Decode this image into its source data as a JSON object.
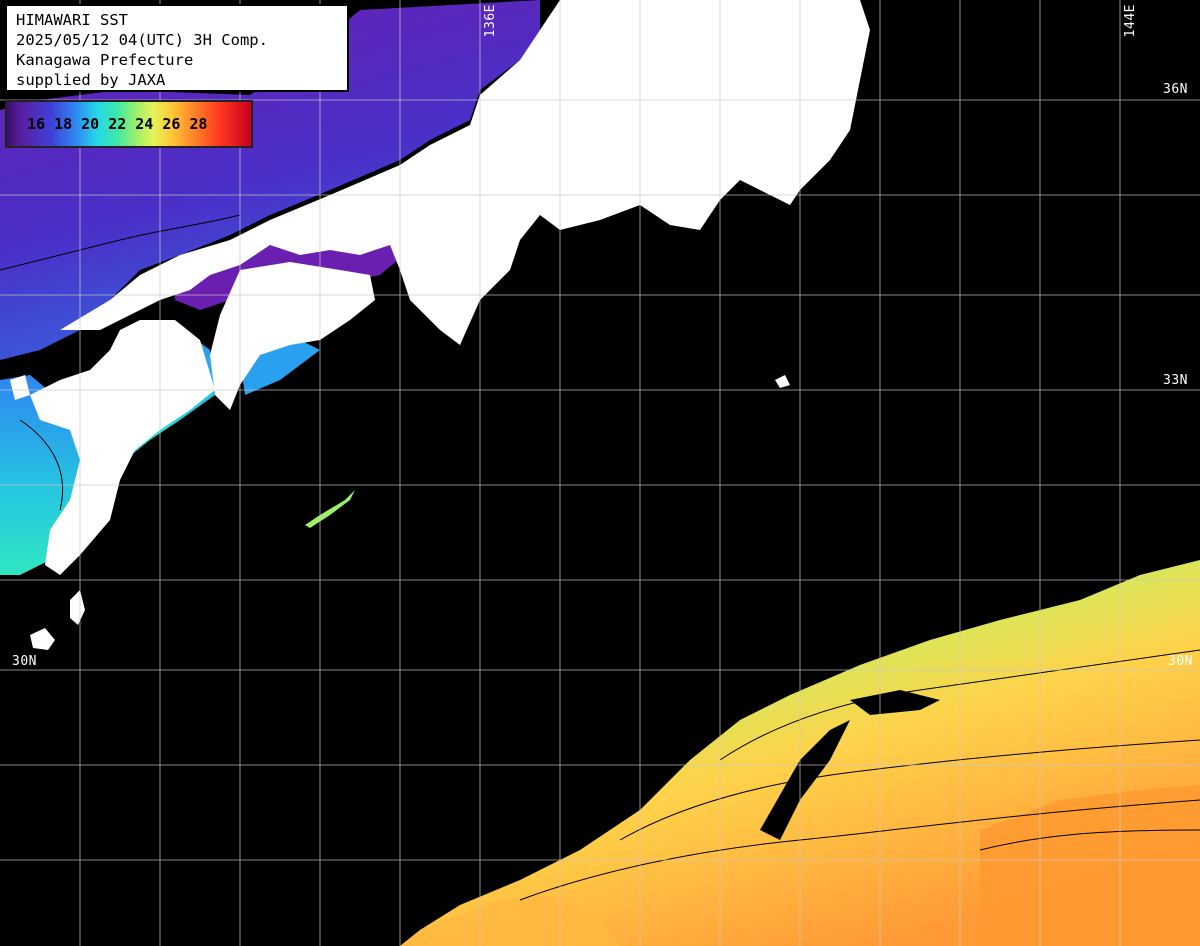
{
  "info": {
    "line1": "HIMAWARI SST",
    "line2": "2025/05/12 04(UTC) 3H Comp.",
    "line3": "Kanagawa Prefecture",
    "line4": "supplied by JAXA"
  },
  "legend": {
    "ticks": [
      "16",
      "18",
      "20",
      "22",
      "24",
      "26",
      "28"
    ],
    "colors": [
      "#3a0f6e",
      "#3f3fd8",
      "#25d8e8",
      "#9cf06a",
      "#ffc435",
      "#ff7a26",
      "#c8001e"
    ]
  },
  "grid": {
    "lat_labels": {
      "lat36": "36N",
      "lat33": "33N",
      "lat30": "30N",
      "lat30_east": "30N"
    },
    "lon_labels": {
      "lon136": "136E",
      "lon144": "144E"
    }
  },
  "colors": {
    "land": "#ffffff",
    "no_data": "#000000",
    "grid": "#bdbdbd",
    "contour": "#000000"
  }
}
